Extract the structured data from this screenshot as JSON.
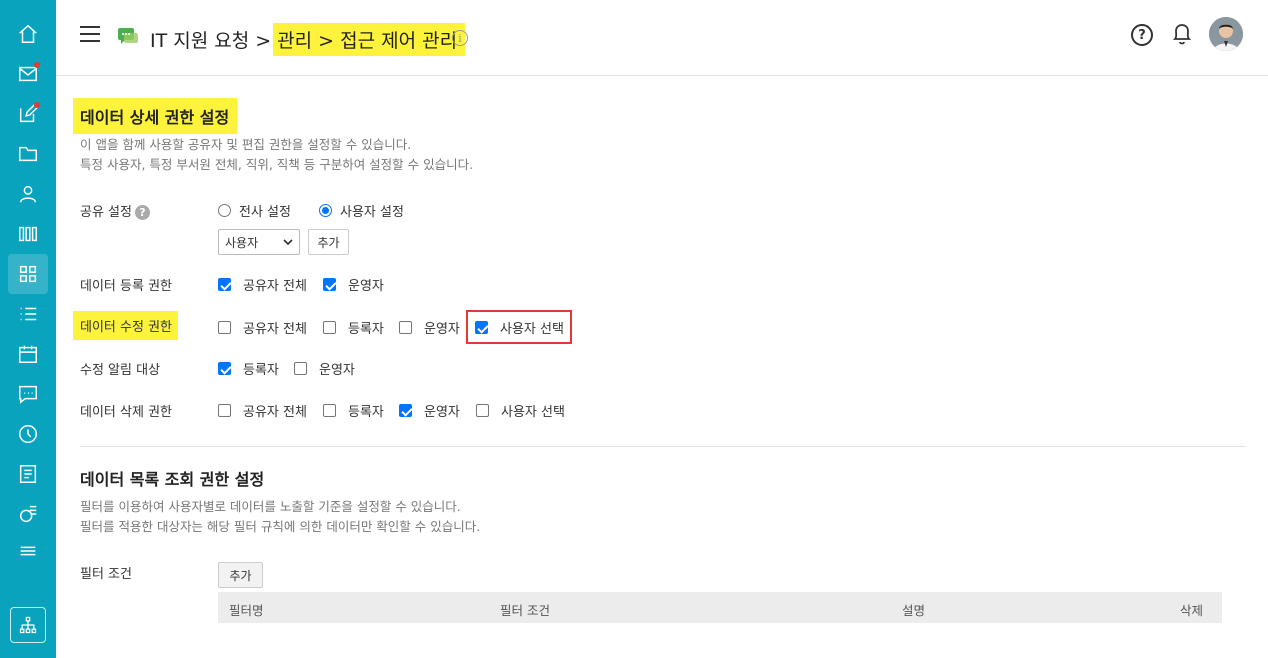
{
  "header": {
    "title_prefix": "IT 지원 요청 >",
    "title_highlight": "관리 > 접근 제어 관리",
    "info_glyph": "i",
    "help_glyph": "?"
  },
  "sidebar": {
    "items": [
      "home-icon",
      "mail-icon",
      "edit-icon",
      "folder-icon",
      "user-icon",
      "board-icon",
      "apps-icon",
      "list-icon",
      "calendar-icon",
      "chat-icon",
      "clock-icon",
      "document-icon",
      "report-icon",
      "layers-icon"
    ],
    "bottom": "org-chart-icon",
    "badge_color": "#e53935"
  },
  "section1": {
    "title": "데이터 상세 권한 설정",
    "desc1": "이 앱을 함께 사용할 공유자 및 편집 권한을 설정할 수 있습니다.",
    "desc2": "특정 사용자, 특정 부서원 전체, 직위, 직책 등 구분하여 설정할 수 있습니다.",
    "share": {
      "label": "공유 설정",
      "help": "?",
      "opt_all": "전사 설정",
      "opt_user": "사용자 설정",
      "selected": "사용자 설정",
      "select_value": "사용자",
      "add": "추가"
    },
    "register": {
      "label": "데이터 등록 권한",
      "o1": "공유자 전체",
      "o2": "운영자"
    },
    "modify": {
      "label": "데이터 수정 권한",
      "o1": "공유자 전체",
      "o2": "등록자",
      "o3": "운영자",
      "o4": "사용자 선택"
    },
    "notify": {
      "label": "수정 알림 대상",
      "o1": "등록자",
      "o2": "운영자"
    },
    "delete": {
      "label": "데이터 삭제 권한",
      "o1": "공유자 전체",
      "o2": "등록자",
      "o3": "운영자",
      "o4": "사용자 선택"
    }
  },
  "section2": {
    "title": "데이터 목록 조회 권한 설정",
    "desc1": "필터를 이용하여 사용자별로 데이터를 노출할 기준을 설정할 수 있습니다.",
    "desc2": "필터를 적용한 대상자는 해당 필터 규칙에 의한 데이터만 확인할 수 있습니다.",
    "filter_label": "필터 조건",
    "add": "추가",
    "columns": [
      "필터명",
      "필터 조건",
      "설명",
      "삭제"
    ]
  },
  "colors": {
    "sidebar": "#0aa3be",
    "highlight": "#fdf33d",
    "checked": "#0075ff",
    "annotation": "#e53935"
  }
}
